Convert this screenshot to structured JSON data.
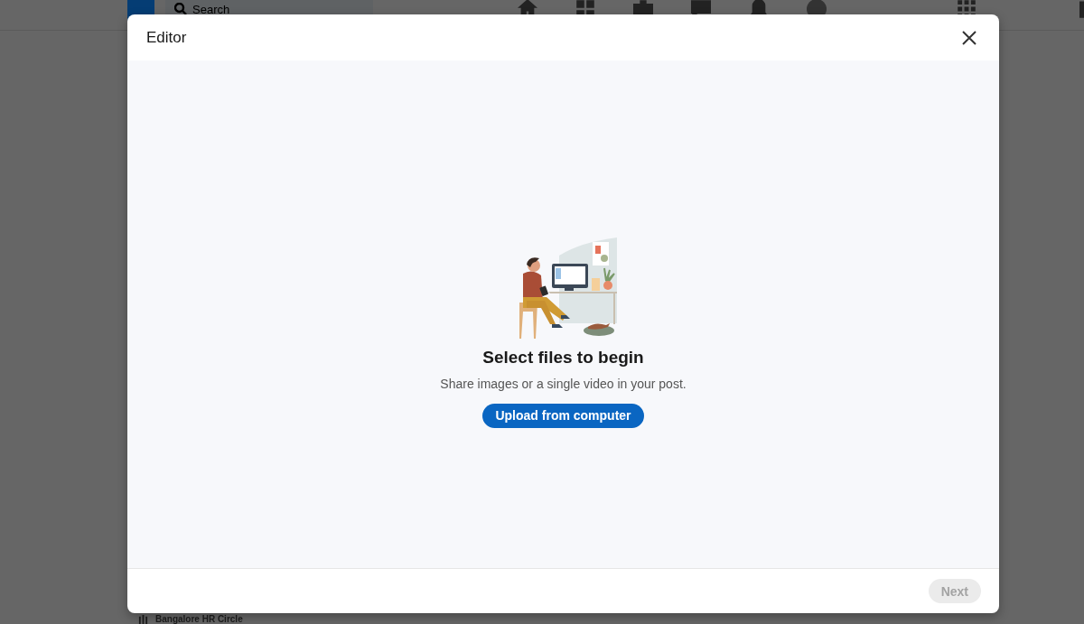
{
  "background": {
    "search": {
      "placeholder": "Search"
    },
    "group_item": "Bangalore HR Circle"
  },
  "dialog": {
    "title": "Editor",
    "heading": "Select files to begin",
    "description": "Share images or a single video in your post.",
    "upload_button": "Upload from computer",
    "next_button": {
      "label": "Next",
      "disabled": true
    }
  }
}
